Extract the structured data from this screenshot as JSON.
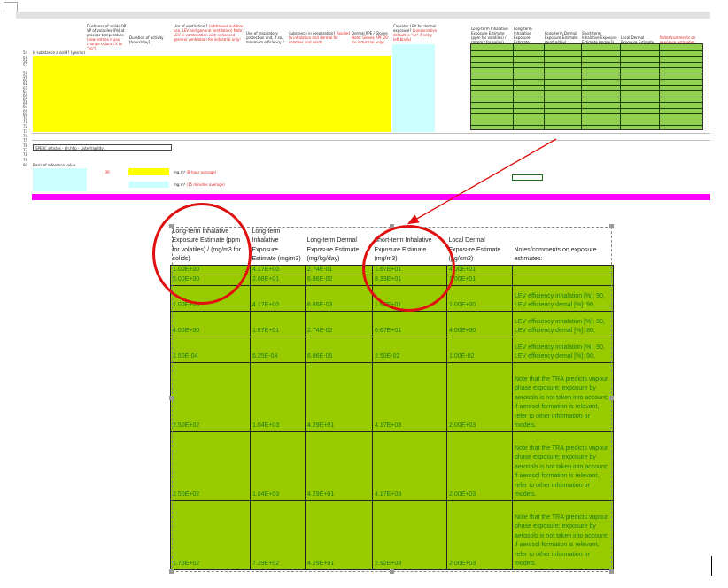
{
  "top_sheet": {
    "row_numbers": [
      "54",
      "55",
      "56",
      "57",
      "58",
      "59",
      "60",
      "61",
      "62",
      "63",
      "64",
      "65",
      "66",
      "67",
      "68",
      "69",
      "70",
      "71",
      "72",
      "73",
      "74",
      "75",
      "76",
      "77",
      "78",
      "79",
      "80"
    ],
    "col_headers": [
      {
        "text": "Is substance a solid? (yes/no)",
        "red": ""
      },
      {
        "text": "Dustiness of solids OR VP of volatiles (Pa) at process temperature",
        "red": "(new entries if you change column X to \"no\")"
      },
      {
        "text": "Duration of activity [hours/day]",
        "red": ""
      },
      {
        "text": "Use of ventilation ?",
        "red": "(addresses outdoor use, LEV and general ventilation) Note: LEV in combination with enhanced general ventilation for industrial only!"
      },
      {
        "text": "Use of respiratory protection and, if so, minimum efficiency ?",
        "red": ""
      },
      {
        "text": "Substance in preparation?",
        "red": "Applied to inhalation and dermal for volatiles and solids"
      },
      {
        "text": "Dermal PPE / Gloves",
        "red": "Note: Gloves APF 20 for industrial only!"
      },
      {
        "text": "Consider LEV for dermal exposure?",
        "red": "(conservative default is \"no\" if entry left blank)"
      }
    ],
    "right_headers": [
      "Long-term Inhalative Exposure Estimate (ppm for volatiles) / (mg/m3 for solids)",
      "Long-term Inhalative Exposure Estimate (mg/m3)",
      "Long-term Dermal Exposure Estimate (mg/kg/day)",
      "Short-term Inhalative Exposure Estimate (mg/m3)",
      "Local Dermal Exposure Estimate (µg/cm2)",
      "Notes/comments on exposure estimates:"
    ],
    "formula_text": "SPERC articles - gh.hhp - Liste fragility",
    "basis_label": "Basis of reference value",
    "or_label": "OR",
    "unit_8h": "mg.m³",
    "unit_8h_note": "(8-hour average)",
    "unit_15m": "mg.m³",
    "unit_15m_note": "(15 minutes average)"
  },
  "table": {
    "headers": [
      "Long-term Inhalative Exposure Estimate (ppm for volatiles) / (mg/m3 for solids)",
      "Long-term Inhalative Exposure Estimate (mg/m3)",
      "Long-term Dermal Exposure Estimate (mg/kg/day)",
      "Short-term Inhalative Exposure Estimate (mg/m3)",
      "Local Dermal Exposure Estimate (µg/cm2)",
      "Notes/comments on exposure estimates:"
    ],
    "rows": [
      [
        "1.00E+00",
        "4.17E+00",
        "2.74E-01",
        "1.67E+01",
        "4.00E+01",
        ""
      ],
      [
        "5.00E+00",
        "2.08E+01",
        "6.86E-02",
        "8.33E+01",
        "1.00E+01",
        ""
      ],
      [
        "1.00E+00",
        "4.17E+00",
        "6.86E-03",
        "1.67E+01",
        "1.00E+00",
        "LEV efficiency inhalation [%]: 90, LEV efficiency demal [%]: 90,"
      ],
      [
        "4.00E+00",
        "1.67E+01",
        "2.74E-02",
        "6.67E+01",
        "4.00E+00",
        "LEV efficiency inhalation [%]: 80, LEV efficiency demal [%]: 80,"
      ],
      [
        "1.50E-04",
        "6.25E-04",
        "6.86E-05",
        "2.50E-02",
        "1.00E-02",
        "LEV efficiency inhalation [%]: 90, LEV efficiency demal [%]: 90,"
      ],
      [
        "2.50E+02",
        "1.04E+03",
        "4.29E+01",
        "4.17E+03",
        "2.00E+03",
        "Note that the TRA predicts vapour phase exposure; exposure by aerosols is not taken into account; if aerosol formation is relevant, refer to other information or models."
      ],
      [
        "2.50E+02",
        "1.04E+03",
        "4.29E+01",
        "4.17E+03",
        "2.00E+03",
        "Note that the TRA predicts vapour phase exposure; exposure by aerosols is not taken into account; if aerosol formation is relevant, refer to other information or models."
      ],
      [
        "1.75E+02",
        "7.29E+02",
        "4.29E+01",
        "2.92E+03",
        "2.00E+03",
        "Note that the TRA predicts vapour phase exposure; exposure by aerosols is not taken into account; if aerosol formation is relevant, refer to other information or models."
      ]
    ]
  },
  "colors": {
    "cell_green": "#99cc00",
    "highlight_yellow": "#ffff00",
    "highlight_cyan": "#ccffff",
    "magenta_bar": "#ff00ff",
    "annotation_red": "#e01010"
  }
}
